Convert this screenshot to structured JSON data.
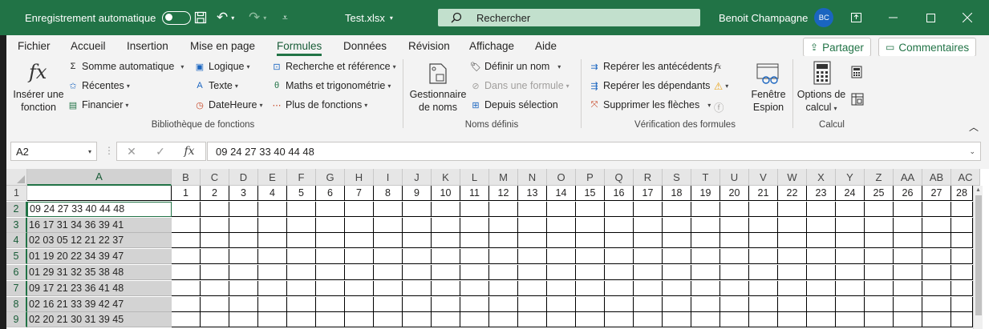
{
  "titlebar": {
    "autosave_label": "Enregistrement automatique",
    "filename": "Test.xlsx",
    "search_placeholder": "Rechercher",
    "user_name": "Benoit Champagne",
    "user_initials": "BC"
  },
  "tabs": [
    "Fichier",
    "Accueil",
    "Insertion",
    "Mise en page",
    "Formules",
    "Données",
    "Révision",
    "Affichage",
    "Aide"
  ],
  "active_tab": "Formules",
  "share_label": "Partager",
  "comments_label": "Commentaires",
  "ribbon": {
    "insert_function": [
      "Insérer une",
      "fonction"
    ],
    "library": {
      "col1": [
        "Somme automatique",
        "Récentes",
        "Financier"
      ],
      "col2": [
        "Logique",
        "Texte",
        "DateHeure"
      ],
      "col3": [
        "Recherche et référence",
        "Maths et trigonométrie",
        "Plus de fonctions"
      ],
      "label": "Bibliothèque de fonctions"
    },
    "names": {
      "manager": [
        "Gestionnaire",
        "de noms"
      ],
      "define": "Définir un nom",
      "use_in_formula": "Dans une formule",
      "from_selection": "Depuis sélection",
      "label": "Noms définis"
    },
    "audit": {
      "precedents": "Repérer les antécédents",
      "dependents": "Repérer les dépendants",
      "remove_arrows": "Supprimer les flèches",
      "watch": [
        "Fenêtre",
        "Espion"
      ],
      "label": "Vérification des formules"
    },
    "calc": {
      "options": [
        "Options de",
        "calcul"
      ],
      "label": "Calcul"
    }
  },
  "formula_bar": {
    "name_box": "A2",
    "value": "09 24 27 33 40 44 48"
  },
  "sheet": {
    "col_letters": [
      "A",
      "B",
      "C",
      "D",
      "E",
      "F",
      "G",
      "H",
      "I",
      "J",
      "K",
      "L",
      "M",
      "N",
      "O",
      "P",
      "Q",
      "R",
      "S",
      "T",
      "U",
      "V",
      "W",
      "X",
      "Y",
      "Z",
      "AA",
      "AB",
      "AC"
    ],
    "row1_numbers": [
      "1",
      "2",
      "3",
      "4",
      "5",
      "6",
      "7",
      "8",
      "9",
      "10",
      "11",
      "12",
      "13",
      "14",
      "15",
      "16",
      "17",
      "18",
      "19",
      "20",
      "21",
      "22",
      "23",
      "24",
      "25",
      "26",
      "27",
      "28"
    ],
    "row_numbers": [
      "1",
      "2",
      "3",
      "4",
      "5",
      "6",
      "7",
      "8",
      "9"
    ],
    "colA_values": [
      "",
      "09 24 27 33 40 44 48",
      "16 17 31 34 36 39 41",
      "02 03 05 12 21 22 37",
      "01 19 20 22 34 39 47",
      "01 29 31 32 35 38 48",
      "09 17 21 23 36 41 48",
      "02 16 21 33 39 42 47",
      "02 20 21 30 31 39 45"
    ]
  }
}
